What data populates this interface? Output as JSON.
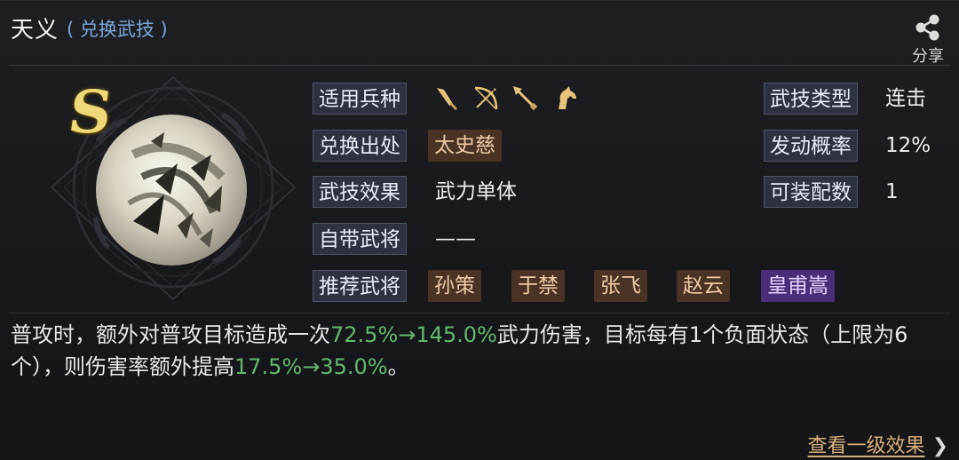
{
  "header": {
    "title": "天义",
    "subtitle": "( 兑换武技 )",
    "share_label": "分享"
  },
  "skill": {
    "rank": "S",
    "rows": {
      "troop_label": "适用兵种",
      "troops": [
        "sword-icon",
        "bow-icon",
        "spear-icon",
        "horse-icon"
      ],
      "source_label": "兑换出处",
      "source_value": "太史慈",
      "effect_label": "武技效果",
      "effect_value": "武力单体",
      "general_label": "自带武将",
      "general_value": "——",
      "recommend_label": "推荐武将",
      "recommend": [
        "孙策",
        "于禁",
        "张飞",
        "赵云",
        "皇甫嵩"
      ]
    },
    "right": {
      "type_label": "武技类型",
      "type_value": "连击",
      "prob_label": "发动概率",
      "prob_value": "12%",
      "equip_label": "可装配数",
      "equip_value": "1"
    }
  },
  "description": {
    "p1": "普攻时，额外对普攻目标造成一次",
    "v1": "72.5%→145.0%",
    "p2": "武力伤害，目标每有1个负面状态（上限为6个），则伤害率额外提高",
    "v2": "17.5%→35.0%",
    "p3": "。"
  },
  "footer": {
    "link": "查看一级效果",
    "chevron": "❯"
  },
  "colors": {
    "accent_green": "#62b86f",
    "chip_orange_bg": "#4a3324",
    "chip_purple_bg": "#4b2e79",
    "link": "#d9b07c"
  }
}
